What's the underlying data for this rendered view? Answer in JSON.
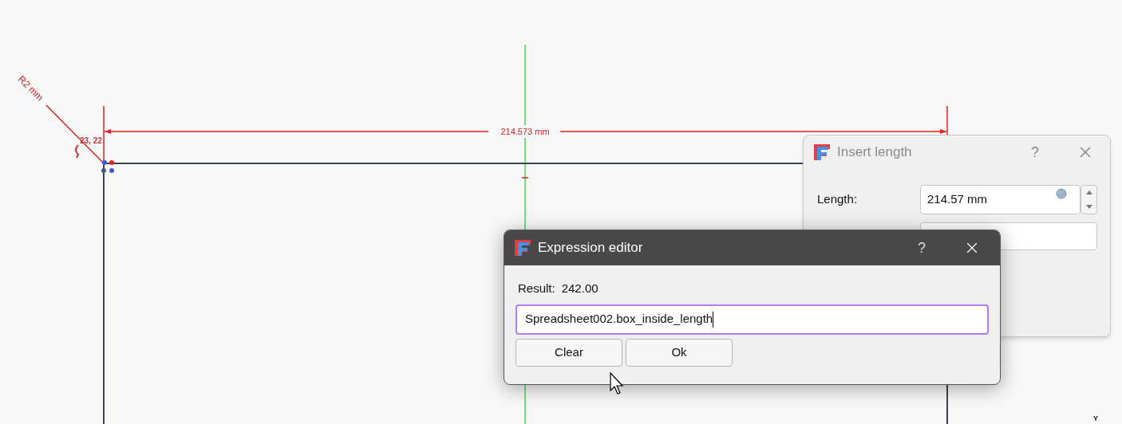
{
  "canvas": {
    "radius_label": "R2 mm",
    "dimension_label": "214.573 mm",
    "coordinate_label": "23, 22",
    "axis_label": "Y"
  },
  "insert_length_dialog": {
    "title": "Insert length",
    "active": false,
    "help": "?",
    "length_label": "Length:",
    "length_value": "214.57 mm"
  },
  "expression_editor": {
    "title": "Expression editor",
    "active": true,
    "help": "?",
    "result_label": "Result:",
    "result_value": "242.00",
    "expression": "Spreadsheet002.box_inside_length",
    "buttons": [
      "Clear",
      "Ok"
    ]
  }
}
